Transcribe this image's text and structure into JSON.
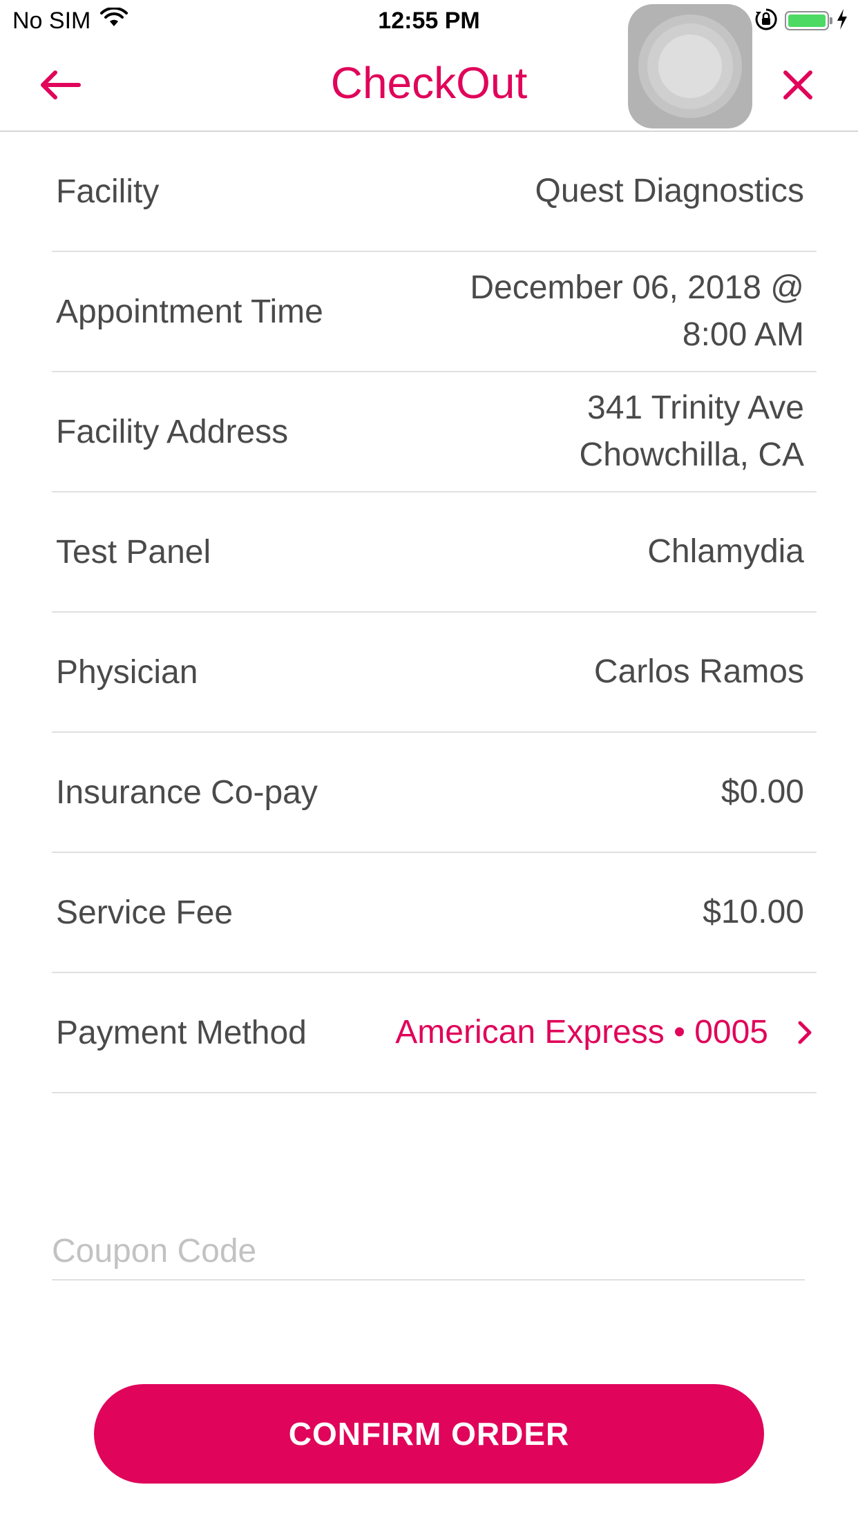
{
  "status_bar": {
    "carrier": "No SIM",
    "time": "12:55 PM",
    "icons": [
      "wifi-icon",
      "orientation-lock-icon",
      "battery-icon",
      "charging-bolt-icon"
    ],
    "battery_fraction": 1.0
  },
  "header": {
    "title": "CheckOut",
    "back_icon": "arrow-left-icon",
    "close_icon": "close-icon"
  },
  "details": {
    "rows": [
      {
        "label": "Facility",
        "value_lines": [
          "Quest Diagnostics"
        ]
      },
      {
        "label": "Appointment Time",
        "value_lines": [
          "December 06, 2018 @",
          "8:00 AM"
        ]
      },
      {
        "label": "Facility Address",
        "value_lines": [
          "341 Trinity Ave",
          "Chowchilla, CA"
        ]
      },
      {
        "label": "Test Panel",
        "value_lines": [
          "Chlamydia"
        ]
      },
      {
        "label": "Physician",
        "value_lines": [
          "Carlos Ramos"
        ]
      },
      {
        "label": "Insurance Co-pay",
        "value_lines": [
          "$0.00"
        ]
      },
      {
        "label": "Service Fee",
        "value_lines": [
          "$10.00"
        ]
      }
    ],
    "payment": {
      "label": "Payment Method",
      "value": "American Express • 0005",
      "icon": "chevron-right-icon"
    }
  },
  "coupon": {
    "placeholder": "Coupon Code",
    "value": ""
  },
  "actions": {
    "confirm_label": "CONFIRM ORDER"
  },
  "colors": {
    "accent": "#e0045a",
    "text": "#4a4a4a",
    "divider": "#e0e0e0"
  }
}
